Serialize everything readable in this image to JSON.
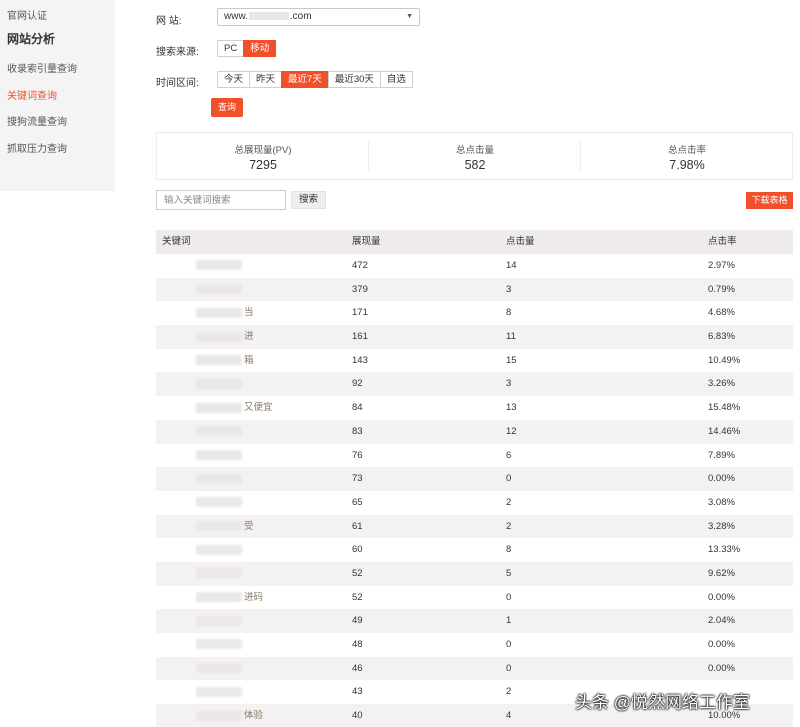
{
  "sidebar": {
    "item_cert": "官网认证",
    "heading": "网站分析",
    "item_index": "收录索引量查询",
    "item_keyword": "关键词查询",
    "item_sogou": "搜狗流量查询",
    "item_crawl": "抓取压力查询"
  },
  "filters": {
    "site_label": "网  站:",
    "site_prefix": "www.",
    "site_suffix": ".com",
    "source_label": "搜索来源:",
    "source_options": [
      "PC",
      "移动"
    ],
    "source_selected": "移动",
    "time_label": "时间区间:",
    "time_options": [
      "今天",
      "昨天",
      "最近7天",
      "最近30天",
      "自选"
    ],
    "time_selected": "最近7天",
    "query_button": "查询"
  },
  "stats": {
    "impressions_label": "总展现量(PV)",
    "impressions_value": "7295",
    "clicks_label": "总点击量",
    "clicks_value": "582",
    "ctr_label": "总点击率",
    "ctr_value": "7.98%"
  },
  "search": {
    "placeholder": "输入关键词搜索",
    "search_button": "搜索",
    "download_button": "下载表格"
  },
  "table": {
    "headers": [
      "关键词",
      "展现量",
      "点击量",
      "点击率"
    ],
    "rows": [
      {
        "kw": "",
        "pv": "472",
        "clicks": "14",
        "ctr": "2.97%"
      },
      {
        "kw": "",
        "pv": "379",
        "clicks": "3",
        "ctr": "0.79%"
      },
      {
        "kw": "当",
        "pv": "171",
        "clicks": "8",
        "ctr": "4.68%"
      },
      {
        "kw": "进",
        "pv": "161",
        "clicks": "11",
        "ctr": "6.83%"
      },
      {
        "kw": "箱",
        "pv": "143",
        "clicks": "15",
        "ctr": "10.49%"
      },
      {
        "kw": "",
        "pv": "92",
        "clicks": "3",
        "ctr": "3.26%"
      },
      {
        "kw": "又便宜",
        "pv": "84",
        "clicks": "13",
        "ctr": "15.48%"
      },
      {
        "kw": "",
        "pv": "83",
        "clicks": "12",
        "ctr": "14.46%"
      },
      {
        "kw": "",
        "pv": "76",
        "clicks": "6",
        "ctr": "7.89%"
      },
      {
        "kw": "",
        "pv": "73",
        "clicks": "0",
        "ctr": "0.00%"
      },
      {
        "kw": "",
        "pv": "65",
        "clicks": "2",
        "ctr": "3.08%"
      },
      {
        "kw": "受",
        "pv": "61",
        "clicks": "2",
        "ctr": "3.28%"
      },
      {
        "kw": "",
        "pv": "60",
        "clicks": "8",
        "ctr": "13.33%"
      },
      {
        "kw": "",
        "pv": "52",
        "clicks": "5",
        "ctr": "9.62%"
      },
      {
        "kw": "进码",
        "pv": "52",
        "clicks": "0",
        "ctr": "0.00%"
      },
      {
        "kw": "",
        "pv": "49",
        "clicks": "1",
        "ctr": "2.04%"
      },
      {
        "kw": "",
        "pv": "48",
        "clicks": "0",
        "ctr": "0.00%"
      },
      {
        "kw": "",
        "pv": "46",
        "clicks": "0",
        "ctr": "0.00%"
      },
      {
        "kw": "",
        "pv": "43",
        "clicks": "2",
        "ctr": ""
      },
      {
        "kw": "体验",
        "pv": "40",
        "clicks": "4",
        "ctr": "10.00%"
      }
    ]
  },
  "watermark": "头条 @悦然网络工作室"
}
